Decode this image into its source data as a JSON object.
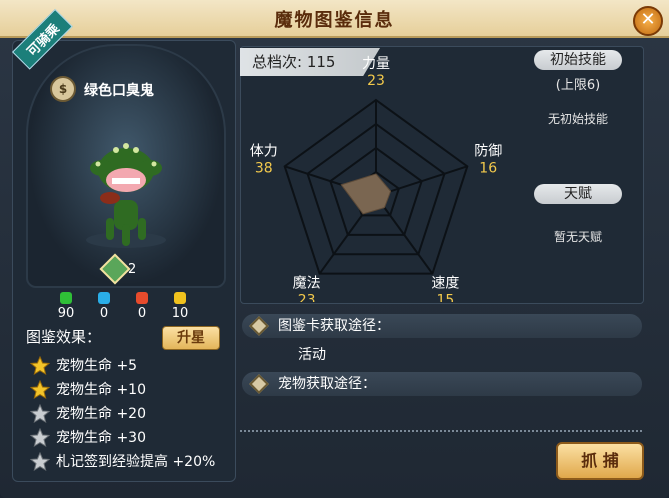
{
  "window": {
    "title": "魔物图鉴信息"
  },
  "monster": {
    "tag": "可骑乘",
    "name": "绿色口臭鬼",
    "count": "2",
    "attributes": [
      {
        "color": "#2fbf37",
        "value": "90"
      },
      {
        "color": "#2aaee8",
        "value": "0"
      },
      {
        "color": "#e74b2c",
        "value": "0"
      },
      {
        "color": "#f0c21e",
        "value": "10"
      }
    ]
  },
  "collection": {
    "label": "图鉴效果：",
    "upgrade_label": "升星",
    "effects": [
      {
        "text": "宠物生命 +5",
        "active": true
      },
      {
        "text": "宠物生命 +10",
        "active": true
      },
      {
        "text": "宠物生命 +20",
        "active": false
      },
      {
        "text": "宠物生命 +30",
        "active": false
      },
      {
        "text": "札记签到经验提高 +20%",
        "active": false
      }
    ]
  },
  "stats": {
    "total_label": "总档次: 115",
    "items": [
      {
        "name": "力量",
        "value": "23"
      },
      {
        "name": "防御",
        "value": "16"
      },
      {
        "name": "速度",
        "value": "15"
      },
      {
        "name": "魔法",
        "value": "23"
      },
      {
        "name": "体力",
        "value": "38"
      }
    ]
  },
  "skills": {
    "initial_label": "初始技能",
    "limit": "(上限6)",
    "none_initial": "无初始技能",
    "talent_label": "天赋",
    "none_talent": "暂无天赋"
  },
  "sources": {
    "card_label": "图鉴卡获取途径：",
    "card_value": "活动",
    "pet_label": "宠物获取途径："
  },
  "actions": {
    "catch_label": "抓 捕"
  }
}
